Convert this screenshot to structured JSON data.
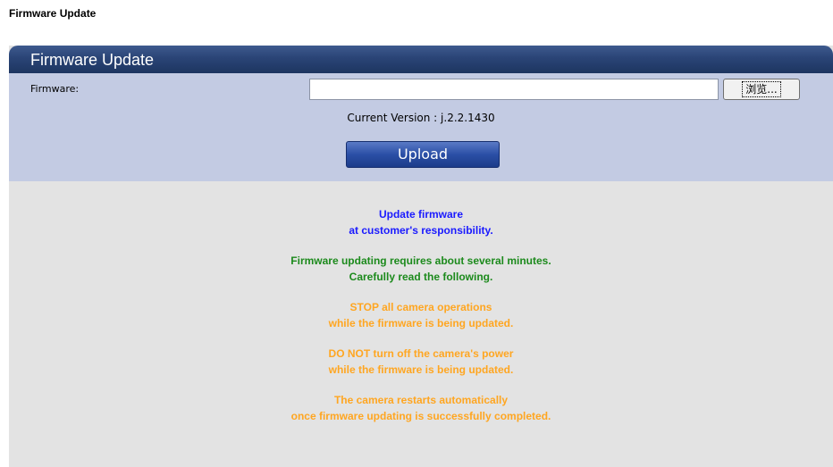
{
  "page": {
    "heading": "Firmware Update"
  },
  "panel": {
    "title": "Firmware Update",
    "firmware_label": "Firmware:",
    "file_input_value": "",
    "browse_label": "浏览...",
    "current_version": "Current Version : j.2.2.1430",
    "upload_label": "Upload"
  },
  "notices": [
    {
      "color": "#1a1aff",
      "lines": [
        "Update firmware",
        "at customer's responsibility."
      ]
    },
    {
      "color": "#1c8a1c",
      "lines": [
        "Firmware updating requires about several minutes.",
        "Carefully read the following."
      ]
    },
    {
      "color": "#ffa621",
      "lines": [
        "STOP all camera operations",
        "while the firmware is being updated."
      ]
    },
    {
      "color": "#ffa621",
      "lines": [
        "DO NOT turn off the camera's power",
        "while the firmware is being updated."
      ]
    },
    {
      "color": "#ffa621",
      "lines": [
        "The camera restarts automatically",
        "once firmware updating is successfully completed."
      ]
    }
  ]
}
